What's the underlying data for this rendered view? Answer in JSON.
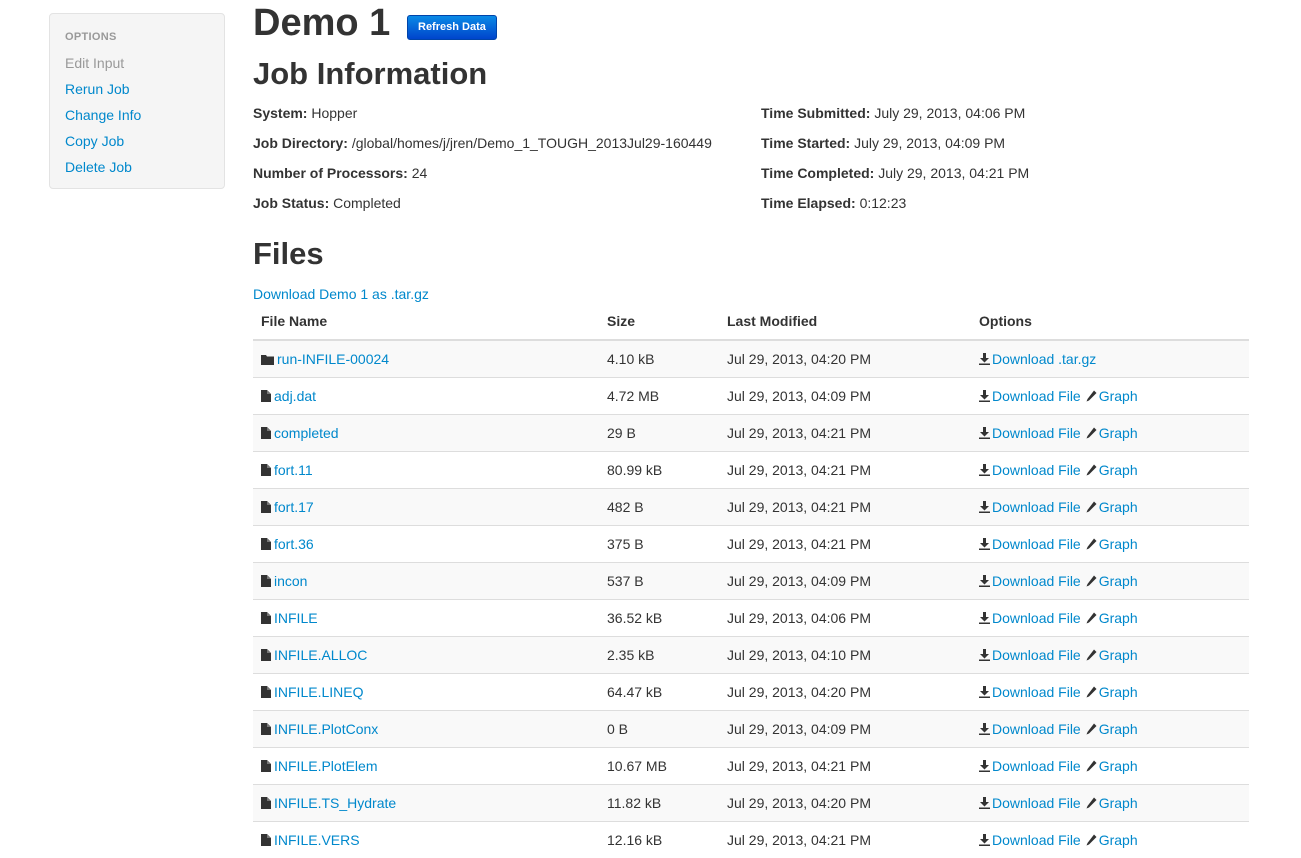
{
  "sidebar": {
    "header": "OPTIONS",
    "items": [
      {
        "label": "Edit Input"
      },
      {
        "label": "Rerun Job"
      },
      {
        "label": "Change Info"
      },
      {
        "label": "Copy Job"
      },
      {
        "label": "Delete Job"
      }
    ]
  },
  "job": {
    "title": "Demo 1",
    "refresh_label": "Refresh Data"
  },
  "job_info": {
    "heading": "Job Information",
    "left": [
      {
        "label": "System:",
        "value": "Hopper"
      },
      {
        "label": "Job Directory:",
        "value": "/global/homes/j/jren/Demo_1_TOUGH_2013Jul29-160449"
      },
      {
        "label": "Number of Processors:",
        "value": "24"
      },
      {
        "label": "Job Status:",
        "value": "Completed"
      }
    ],
    "right": [
      {
        "label": "Time Submitted:",
        "value": "July 29, 2013, 04:06 PM"
      },
      {
        "label": "Time Started:",
        "value": "July 29, 2013, 04:09 PM"
      },
      {
        "label": "Time Completed:",
        "value": "July 29, 2013, 04:21 PM"
      },
      {
        "label": "Time Elapsed:",
        "value": "0:12:23"
      }
    ]
  },
  "files": {
    "heading": "Files",
    "download_all": "Download Demo 1 as .tar.gz",
    "columns": [
      "File Name",
      "Size",
      "Last Modified",
      "Options"
    ],
    "option_labels": {
      "download_targz": "Download .tar.gz",
      "download_file": "Download File",
      "graph": "Graph"
    },
    "rows": [
      {
        "name": "run-INFILE-00024",
        "size": "4.10 kB",
        "modified": "Jul 29, 2013, 04:20 PM",
        "icon": "folder-icon"
      },
      {
        "name": "adj.dat",
        "size": "4.72 MB",
        "modified": "Jul 29, 2013, 04:09 PM",
        "icon": "file-icon"
      },
      {
        "name": "completed",
        "size": "29 B",
        "modified": "Jul 29, 2013, 04:21 PM",
        "icon": "file-icon"
      },
      {
        "name": "fort.11",
        "size": "80.99 kB",
        "modified": "Jul 29, 2013, 04:21 PM",
        "icon": "file-icon"
      },
      {
        "name": "fort.17",
        "size": "482 B",
        "modified": "Jul 29, 2013, 04:21 PM",
        "icon": "file-icon"
      },
      {
        "name": "fort.36",
        "size": "375 B",
        "modified": "Jul 29, 2013, 04:21 PM",
        "icon": "file-icon"
      },
      {
        "name": "incon",
        "size": "537 B",
        "modified": "Jul 29, 2013, 04:09 PM",
        "icon": "file-icon"
      },
      {
        "name": "INFILE",
        "size": "36.52 kB",
        "modified": "Jul 29, 2013, 04:06 PM",
        "icon": "file-icon"
      },
      {
        "name": "INFILE.ALLOC",
        "size": "2.35 kB",
        "modified": "Jul 29, 2013, 04:10 PM",
        "icon": "file-icon"
      },
      {
        "name": "INFILE.LINEQ",
        "size": "64.47 kB",
        "modified": "Jul 29, 2013, 04:20 PM",
        "icon": "file-icon"
      },
      {
        "name": "INFILE.PlotConx",
        "size": "0 B",
        "modified": "Jul 29, 2013, 04:09 PM",
        "icon": "file-icon"
      },
      {
        "name": "INFILE.PlotElem",
        "size": "10.67 MB",
        "modified": "Jul 29, 2013, 04:21 PM",
        "icon": "file-icon"
      },
      {
        "name": "INFILE.TS_Hydrate",
        "size": "11.82 kB",
        "modified": "Jul 29, 2013, 04:20 PM",
        "icon": "file-icon"
      },
      {
        "name": "INFILE.VERS",
        "size": "12.16 kB",
        "modified": "Jul 29, 2013, 04:21 PM",
        "icon": "file-icon"
      }
    ]
  },
  "colors": {
    "link": "#0088cc",
    "button": "#0055dd",
    "sidebar_bg": "#f5f5f5",
    "row_stripe": "#f9f9f9"
  }
}
